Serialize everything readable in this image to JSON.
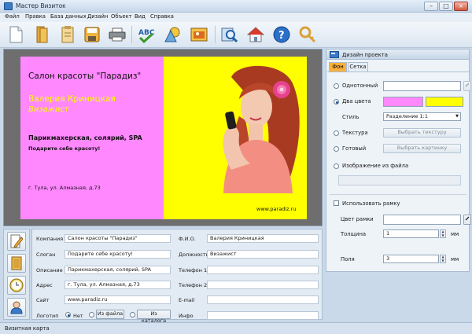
{
  "window": {
    "title": "Мастер Визиток",
    "minimize": "–",
    "maximize": "□",
    "close": "×"
  },
  "menu": [
    "Файл",
    "Правка",
    "База данных",
    "Дизайн",
    "Объект",
    "Вид",
    "Справка"
  ],
  "toolbar": {
    "icons": [
      "new-document-icon",
      "open-folder-icon",
      "templates-icon",
      "save-icon",
      "print-icon",
      "spell-check-icon",
      "shapes-icon",
      "image-icon",
      "zoom-icon",
      "home-icon",
      "help-icon",
      "settings-icon"
    ]
  },
  "card": {
    "company": "Салон красоты \"Парадиз\"",
    "name": "Валерия Криницкая",
    "position": "Визажист",
    "description": "Парикмахерская, солярий, SPA",
    "slogan": "Подарите себе красоту!",
    "address": "г. Тула, ул. Алмазная, д.73",
    "site": "www.paradiz.ru",
    "colors": {
      "left": "#ff88ff",
      "right": "#ffff00",
      "name_color": "#ffff00",
      "position_color": "#ffff00"
    }
  },
  "design_panel": {
    "title": "Дизайн проекта",
    "tabs": [
      "Фон",
      "Сетка"
    ],
    "options": {
      "solid": "Однотонный",
      "two_colors": "Два цвета",
      "style_label": "Стиль",
      "style_value": "Разделение 1:1",
      "texture": "Текстура",
      "select_texture": "Выбрать текстуру",
      "ready": "Готовый",
      "select_picture": "Выбрать картинку",
      "image_from_file": "Изображение из файла"
    },
    "colors": {
      "solid": "#ffffff",
      "color1": "#ff88ff",
      "color2": "#ffff00",
      "frame": "#ffffff"
    },
    "frame": {
      "use_frame": "Использовать рамку",
      "frame_color": "Цвет рамки",
      "thickness_label": "Толщина",
      "thickness_value": "1",
      "thickness_unit": "мм",
      "margins_label": "Поля",
      "margins_value": "3",
      "margins_unit": "мм"
    }
  },
  "form": {
    "left": [
      {
        "label": "Компания",
        "value": "Салон красоты \"Парадиз\""
      },
      {
        "label": "Слоган",
        "value": "Подарите себе красоту!"
      },
      {
        "label": "Описание",
        "value": "Парикмахерская, солярий, SPA"
      },
      {
        "label": "Адрес",
        "value": "г. Тула, ул. Алмазная, д.73"
      },
      {
        "label": "Сайт",
        "value": "www.paradiz.ru"
      }
    ],
    "right": [
      {
        "label": "Ф.И.О.",
        "value": "Валерия Криницкая"
      },
      {
        "label": "Должность",
        "value": "Визажист"
      },
      {
        "label": "Телефон 1",
        "value": ""
      },
      {
        "label": "Телефон 2",
        "value": ""
      },
      {
        "label": "E-mail",
        "value": ""
      },
      {
        "label": "Инфо",
        "value": ""
      }
    ],
    "logo": {
      "label": "Логотип",
      "none": "Нет",
      "from_file": "Из файла",
      "from_catalog": "Из каталога"
    }
  },
  "status": "Визитная карта"
}
